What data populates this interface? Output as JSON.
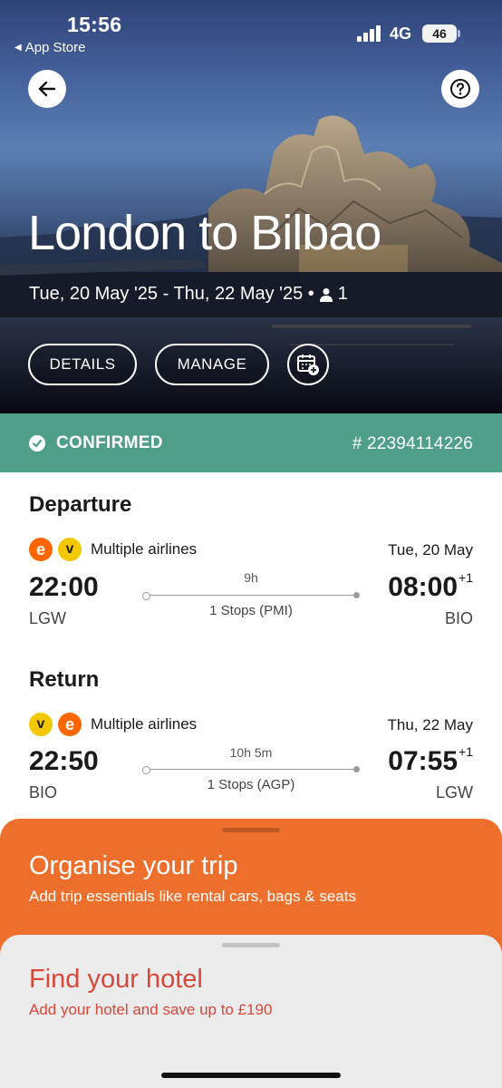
{
  "status_bar": {
    "time": "15:56",
    "back_app": "App Store",
    "network": "4G",
    "battery": "46"
  },
  "hero": {
    "title": "London to Bilbao",
    "subtitle": "Tue, 20 May '25 - Thu, 22 May '25 •",
    "passengers": "1",
    "buttons": {
      "details": "DETAILS",
      "manage": "MANAGE"
    }
  },
  "banner": {
    "status": "CONFIRMED",
    "booking_ref": "# 22394114226",
    "color": "#4e9e89"
  },
  "departure": {
    "title": "Departure",
    "airlines_label": "Multiple airlines",
    "date": "Tue, 20 May",
    "depart_time": "22:00",
    "depart_airport": "LGW",
    "duration": "9h",
    "stops": "1 Stops (PMI)",
    "arrive_time": "08:00",
    "arrive_offset": "+1",
    "arrive_airport": "BIO",
    "airline_logos": [
      "easyjet-logo",
      "vueling-logo"
    ]
  },
  "return": {
    "title": "Return",
    "airlines_label": "Multiple airlines",
    "date": "Thu, 22 May",
    "depart_time": "22:50",
    "depart_airport": "BIO",
    "duration": "10h 5m",
    "stops": "1 Stops (AGP)",
    "arrive_time": "07:55",
    "arrive_offset": "+1",
    "arrive_airport": "LGW",
    "airline_logos": [
      "vueling-logo",
      "easyjet-logo"
    ]
  },
  "organise": {
    "title": "Organise your trip",
    "subtitle": "Add trip essentials like rental cars, bags & seats",
    "color": "#ee6f2c"
  },
  "hotel": {
    "title": "Find your hotel",
    "subtitle": "Add your hotel and save up to £190",
    "color": "#d9473a"
  },
  "logos": {
    "easyjet_letter": "e",
    "vueling_letter": "v"
  }
}
